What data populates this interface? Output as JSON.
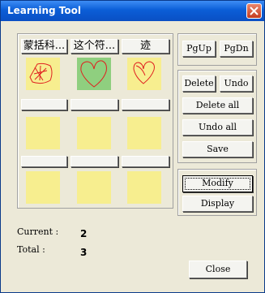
{
  "window": {
    "title": "Learning Tool"
  },
  "grid": {
    "headers": [
      "蒙括科...",
      "这个符...",
      "迹"
    ],
    "rows": [
      [
        {
          "drawing": "star-in-heart-icon"
        },
        {
          "drawing": "heart-icon",
          "selected": true
        },
        {
          "drawing": "heart-icon"
        }
      ],
      [
        {},
        {},
        {}
      ],
      [
        {},
        {},
        {}
      ]
    ]
  },
  "nav": {
    "pgup": "PgUp",
    "pgdn": "PgDn"
  },
  "edit": {
    "delete": "Delete",
    "undo": "Undo",
    "delete_all": "Delete all",
    "undo_all": "Undo all",
    "save": "Save"
  },
  "actions": {
    "modify": "Modify",
    "display": "Display"
  },
  "status": {
    "current_label": "Current :",
    "current_value": "2",
    "total_label": "Total :",
    "total_value": "3"
  },
  "footer": {
    "close": "Close"
  },
  "colors": {
    "title_bar": "#0b5ed7",
    "cell_yellow": "#f7ee8f",
    "cell_selected": "#8fcf7f",
    "ink": "#e02020"
  }
}
